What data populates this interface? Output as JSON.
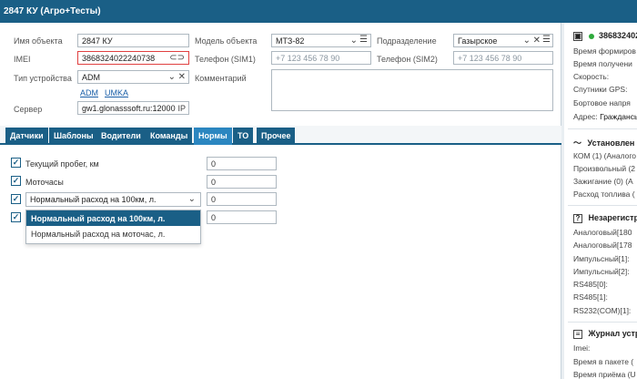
{
  "window": {
    "title": "2847 КУ (Агро+Тесты)"
  },
  "form": {
    "name_label": "Имя объекта",
    "name_value": "2847 КУ",
    "imei_label": "IMEI",
    "imei_value": "3868324022240738",
    "device_type_label": "Тип устройства",
    "device_type_value": "ADM",
    "link_adm": "ADM",
    "link_umka": "UMKA",
    "server_label": "Сервер",
    "server_value": "gw1.glonasssoft.ru:12000",
    "server_suffix": "IP",
    "model_label": "Модель объекта",
    "model_value": "МТЗ-82",
    "sim1_label": "Телефон (SIM1)",
    "sim1_placeholder": "+7 123 456 78 90",
    "comment_label": "Комментарий",
    "division_label": "Подразделение",
    "division_value": "Газырское",
    "sim2_label": "Телефон (SIM2)",
    "sim2_placeholder": "+7 123 456 78 90"
  },
  "tabs": [
    "Датчики",
    "Шаблоны",
    "Водители",
    "Команды",
    "Нормы",
    "ТО",
    "Прочее"
  ],
  "norms": {
    "rows": [
      {
        "label": "Текущий пробег, км",
        "value": "0"
      },
      {
        "label": "Моточасы",
        "value": "0"
      },
      {
        "label": "Нормальный расход на 100км, л.",
        "value": "0"
      },
      {
        "label": "",
        "value": "0"
      }
    ],
    "dropdown_options": [
      "Нормальный расход на 100км, л.",
      "Нормальный расход на моточас, л."
    ]
  },
  "right_panel": {
    "device_title": "38683240224",
    "status_rows": [
      "Время формиров",
      "Время получени",
      "Скорость:",
      "Спутники GPS:",
      "Бортовое напря",
      "Адрес:"
    ],
    "address_value": "Граждансь",
    "installed_title": "Установлен",
    "installed_rows": [
      "КОМ (1) (Аналого",
      "Произвольный (2",
      "Зажигание (0) (А",
      "Расход топлива ("
    ],
    "unregistered_title": "Незарегистр",
    "unregistered_rows": [
      "Аналоговый[180",
      "Аналоговый[178",
      "Импульсный[1]:",
      "Импульсный[2]:",
      "RS485[0]:",
      "RS485[1]:",
      "RS232(COM)[1]:"
    ],
    "journal_title": "Журнал устр",
    "journal_rows": [
      "Imei:",
      "Время в пакете (",
      "Время приёма (U"
    ]
  },
  "colors": {
    "header": "#1a5f86",
    "active_tab": "#2b86c0",
    "status_online": "#2eaa3c",
    "invalid_border": "#e04040"
  }
}
